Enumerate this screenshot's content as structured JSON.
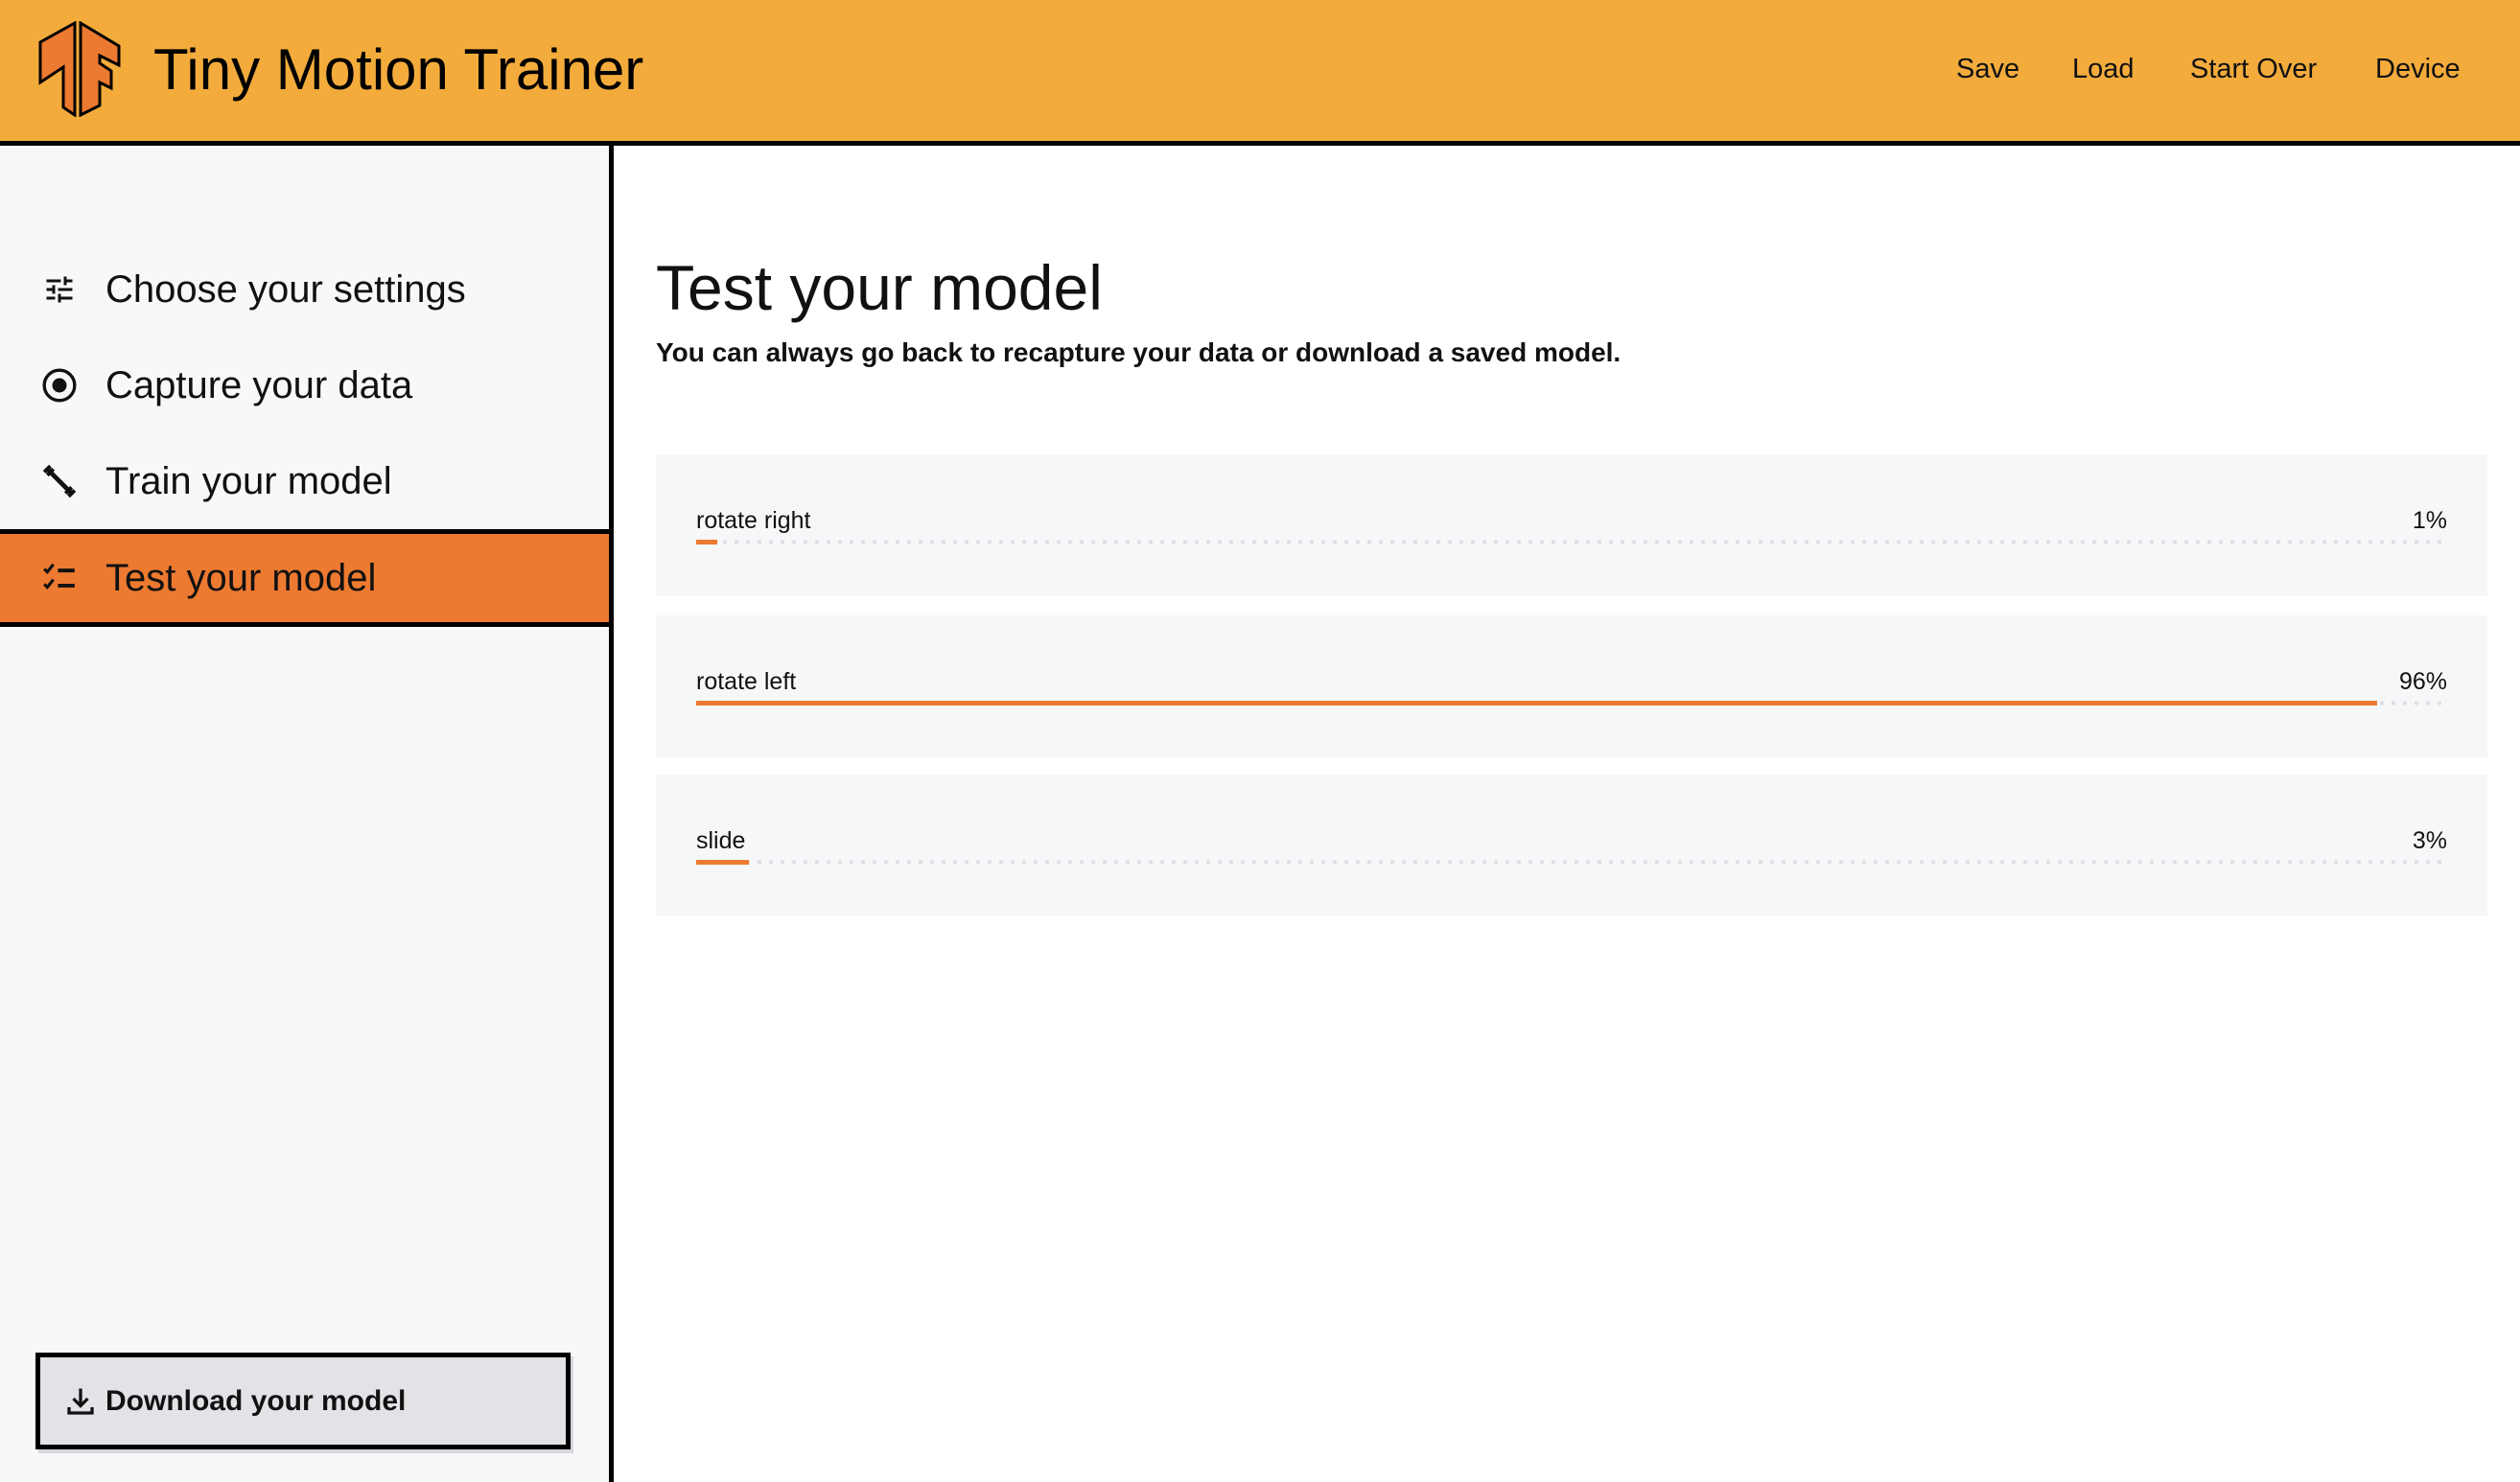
{
  "header": {
    "title": "Tiny Motion Trainer",
    "links": [
      "Save",
      "Load",
      "Start Over",
      "Device"
    ],
    "brand_color": "#f3ab3c"
  },
  "sidebar": {
    "items": [
      {
        "label": "Choose your settings",
        "icon": "tune-icon"
      },
      {
        "label": "Capture your data",
        "icon": "radio-button-icon"
      },
      {
        "label": "Train your model",
        "icon": "fitness-dumbbell-icon"
      },
      {
        "label": "Test your model",
        "icon": "checklist-icon",
        "active": true
      }
    ],
    "download_label": "Download your model",
    "active_color": "#ed7a31"
  },
  "main": {
    "title": "Test your model",
    "subtitle": "You can always go back to recapture your data or download a saved model.",
    "predictions": [
      {
        "label": "rotate right",
        "value": 1,
        "display": "1%"
      },
      {
        "label": "rotate left",
        "value": 96,
        "display": "96%"
      },
      {
        "label": "slide",
        "value": 3,
        "display": "3%"
      }
    ]
  }
}
